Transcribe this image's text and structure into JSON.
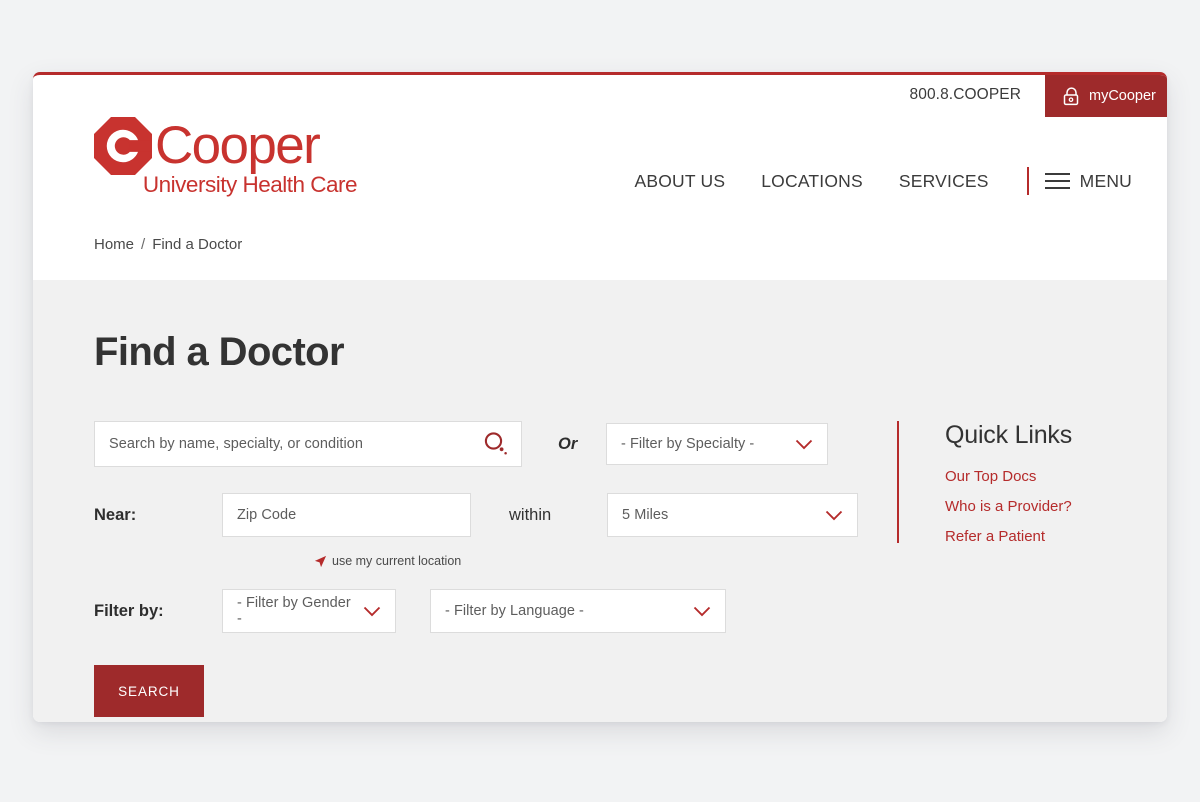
{
  "topbar": {
    "phone": "800.8.COOPER",
    "mycooper_label": "myCooper",
    "lock_icon": "lock-icon"
  },
  "logo": {
    "mark_icon": "cooper-octagon-c-icon",
    "wordmark": "Cooper",
    "tagline": "University Health Care",
    "color": "#c8332f"
  },
  "nav": {
    "items": [
      {
        "label": "ABOUT US"
      },
      {
        "label": "LOCATIONS"
      },
      {
        "label": "SERVICES"
      }
    ],
    "menu_label": "MENU",
    "menu_icon": "hamburger-icon",
    "divider_color": "#b52b2b"
  },
  "breadcrumb": {
    "home": "Home",
    "separator": "/",
    "current": "Find a Doctor"
  },
  "main": {
    "title": "Find a Doctor",
    "search": {
      "placeholder": "Search by name, specialty, or condition",
      "value": "",
      "icon": "search-magnifier-icon"
    },
    "or_label": "Or",
    "specialty": {
      "selected": "- Filter by Specialty -",
      "chevron_icon": "chevron-down-icon"
    },
    "near_label": "Near:",
    "zip": {
      "placeholder": "Zip Code",
      "value": ""
    },
    "within_label": "within",
    "distance": {
      "selected": "5 Miles",
      "chevron_icon": "chevron-down-icon"
    },
    "geolocate": {
      "label": "use my current location",
      "icon": "location-arrow-icon"
    },
    "filter_by_label": "Filter by:",
    "gender": {
      "selected": "- Filter by Gender -",
      "chevron_icon": "chevron-down-icon"
    },
    "language": {
      "selected": "- Filter by Language -",
      "chevron_icon": "chevron-down-icon"
    },
    "search_button": "SEARCH"
  },
  "quick_links": {
    "title": "Quick Links",
    "items": [
      {
        "label": "Our Top Docs"
      },
      {
        "label": "Who is a Provider?"
      },
      {
        "label": "Refer a Patient"
      }
    ],
    "accent_color": "#b52b2b"
  }
}
